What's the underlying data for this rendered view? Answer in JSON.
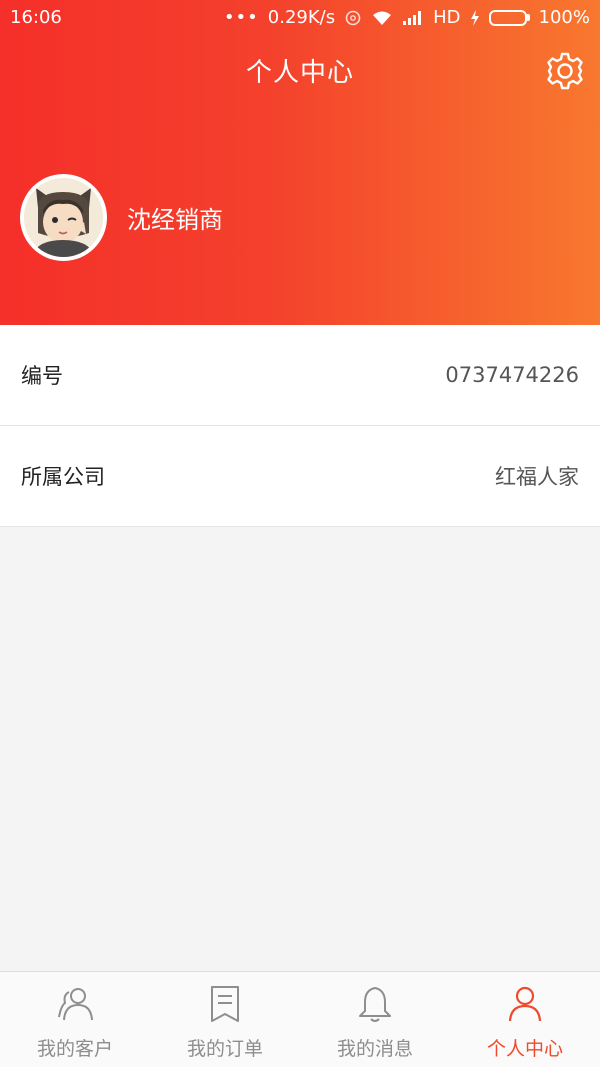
{
  "status_bar": {
    "time": "16:06",
    "dots": "•••",
    "speed": "0.29K/s",
    "network": "HD",
    "battery": "100%",
    "battery_level": 1.0
  },
  "header": {
    "title": "个人中心",
    "user_name": "沈经销商"
  },
  "info": {
    "id_label": "编号",
    "id_value": "0737474226",
    "company_label": "所属公司",
    "company_value": "红福人家"
  },
  "tabbar": {
    "tabs": [
      {
        "label": "我的客户",
        "icon": "customers-icon",
        "active": false
      },
      {
        "label": "我的订单",
        "icon": "orders-icon",
        "active": false
      },
      {
        "label": "我的消息",
        "icon": "bell-icon",
        "active": false
      },
      {
        "label": "个人中心",
        "icon": "person-icon",
        "active": true
      }
    ]
  },
  "colors": {
    "accent": "#f04a2c",
    "header_start": "#f52f2a",
    "header_end": "#f8782f",
    "inactive": "#8e8e8e"
  }
}
